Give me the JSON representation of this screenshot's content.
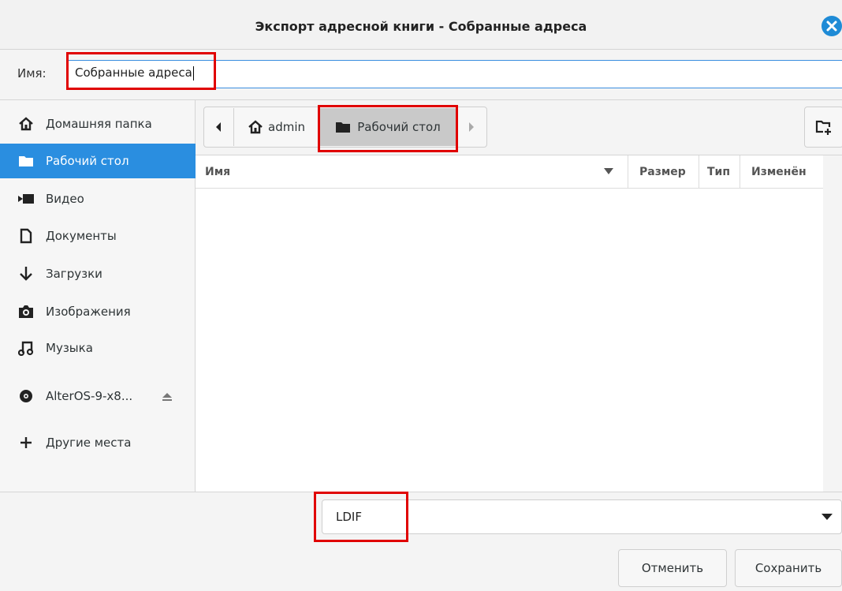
{
  "window": {
    "title": "Экспорт адресной книги - Собранные адреса"
  },
  "name_field": {
    "label": "Имя:",
    "value": "Собранные адреса"
  },
  "sidebar": {
    "items": [
      {
        "label": "Домашняя папка",
        "icon": "home-icon"
      },
      {
        "label": "Рабочий стол",
        "icon": "folder-icon",
        "selected": true
      },
      {
        "label": "Видео",
        "icon": "video-icon"
      },
      {
        "label": "Документы",
        "icon": "document-icon"
      },
      {
        "label": "Загрузки",
        "icon": "download-icon"
      },
      {
        "label": "Изображения",
        "icon": "camera-icon"
      },
      {
        "label": "Музыка",
        "icon": "music-icon"
      },
      {
        "label": "AlterOS-9-x8...",
        "icon": "disc-icon"
      },
      {
        "label": "Другие места",
        "icon": "plus-icon"
      }
    ]
  },
  "pathbar": {
    "segments": [
      "admin",
      "Рабочий стол"
    ]
  },
  "file_list": {
    "columns": {
      "name": "Имя",
      "size": "Размер",
      "type": "Тип",
      "modified": "Изменён"
    },
    "rows": []
  },
  "filter": {
    "value": "LDIF"
  },
  "buttons": {
    "cancel": "Отменить",
    "save": "Сохранить"
  },
  "colors": {
    "accent": "#2a8ee0",
    "highlight": "#e00000"
  }
}
